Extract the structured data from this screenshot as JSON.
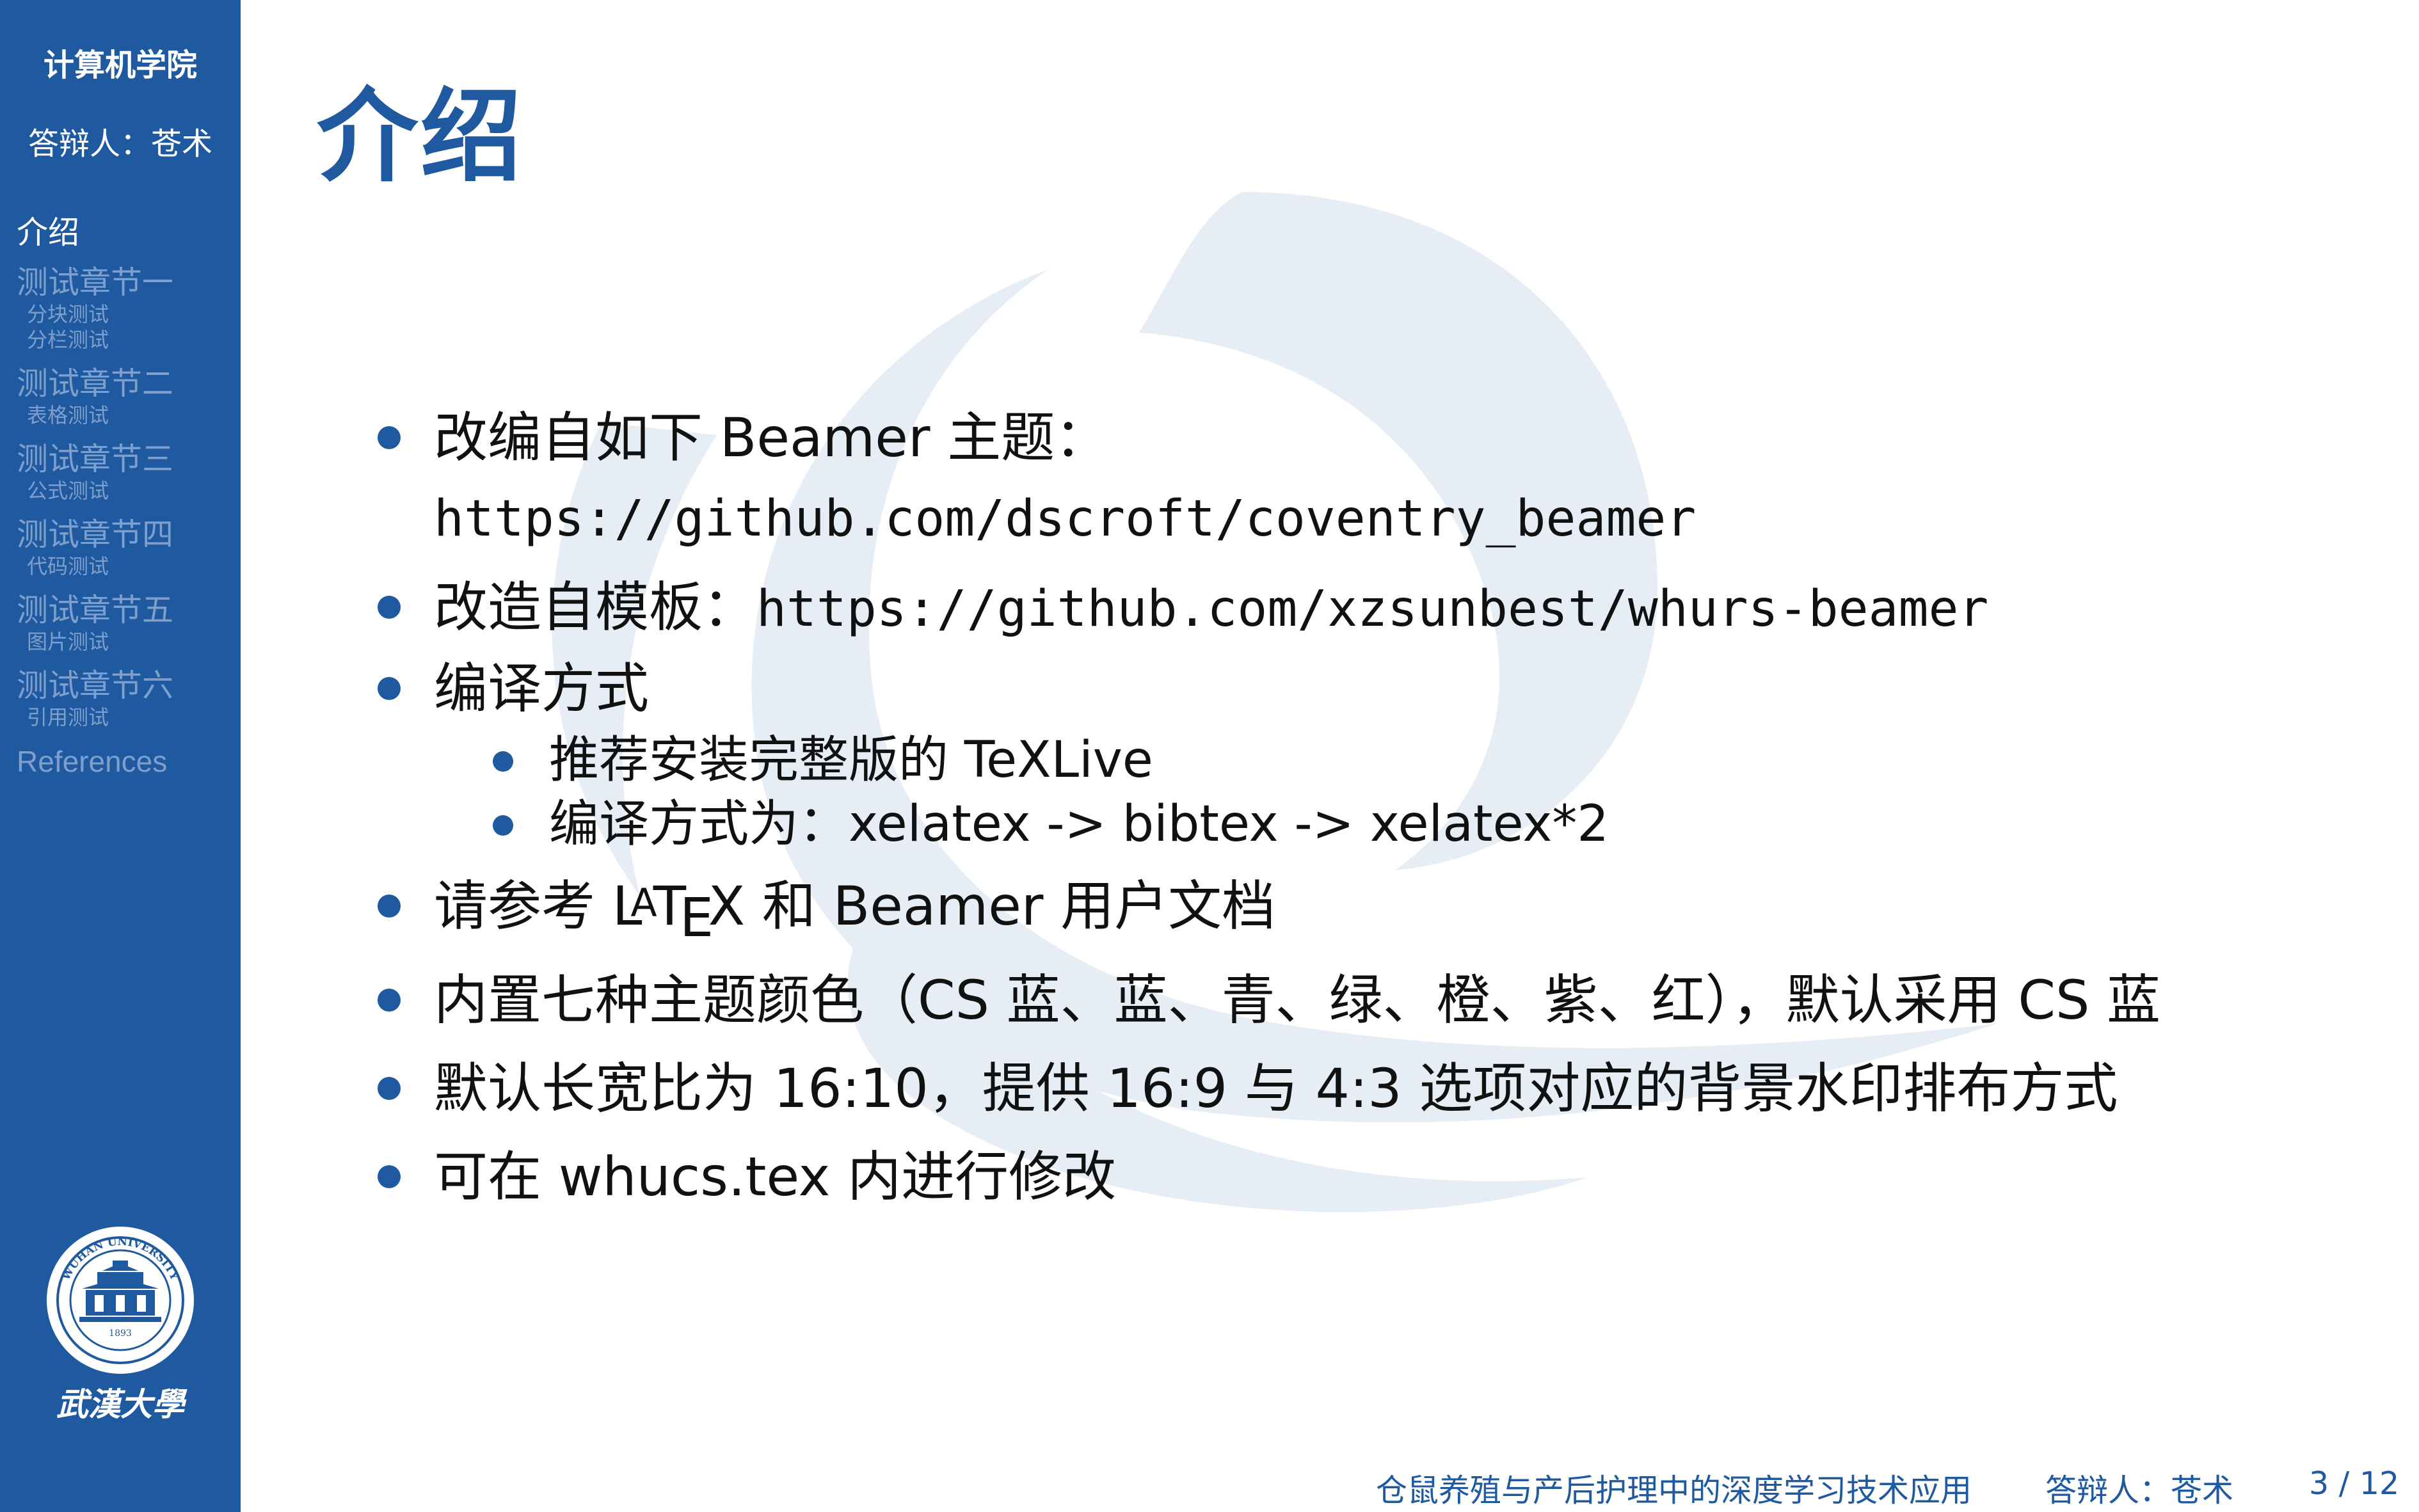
{
  "sidebar": {
    "school": "计算机学院",
    "author": "答辩人：苍术",
    "nav": [
      {
        "label": "介绍",
        "active": true,
        "subs": []
      },
      {
        "label": "测试章节一",
        "subs": [
          "分块测试",
          "分栏测试"
        ]
      },
      {
        "label": "测试章节二",
        "subs": [
          "表格测试"
        ]
      },
      {
        "label": "测试章节三",
        "subs": [
          "公式测试"
        ]
      },
      {
        "label": "测试章节四",
        "subs": [
          "代码测试"
        ]
      },
      {
        "label": "测试章节五",
        "subs": [
          "图片测试"
        ]
      },
      {
        "label": "测试章节六",
        "subs": [
          "引用测试"
        ]
      },
      {
        "label": "References",
        "subs": []
      }
    ],
    "logo_icon": "wuhan-university-logo",
    "logo_ring_text": "WUHAN UNIVERSITY",
    "logo_year": "1893",
    "logo_calligraphy": "武漢大學"
  },
  "slide": {
    "title": "介绍",
    "items": {
      "i1": {
        "text": "改编自如下 Beamer 主题：",
        "code": "https://github.com/dscroft/coventry_beamer"
      },
      "i2": {
        "text": "改造自模板：",
        "code": "https://github.com/xzsunbest/whurs-beamer"
      },
      "i3": {
        "text": "编译方式",
        "sub1": "推荐安装完整版的 TeXLive",
        "sub2": "编译方式为：xelatex -> bibtex -> xelatex*2"
      },
      "i4": {
        "pre": "请参考",
        "latex_L": "L",
        "latex_A": "A",
        "latex_T": "T",
        "latex_E": "E",
        "latex_X": "X",
        "post": "和 Beamer 用户文档"
      },
      "i5": {
        "text": "内置七种主题颜色（CS 蓝、蓝、青、绿、橙、紫、红），默认采用 CS 蓝"
      },
      "i6": {
        "text": "默认长宽比为 16:10，提供 16:9 与 4:3 选项对应的背景水印排布方式"
      },
      "i7": {
        "text": "可在 whucs.tex 内进行修改"
      }
    }
  },
  "footer": {
    "talk_title": "仓鼠养殖与产后护理中的深度学习技术应用",
    "author": "答辩人：苍术",
    "page": "3 / 12"
  },
  "colors": {
    "accent": "#1f5aa0",
    "nav_inactive": "#7e9ecb",
    "watermark": "#e6ecf4"
  }
}
